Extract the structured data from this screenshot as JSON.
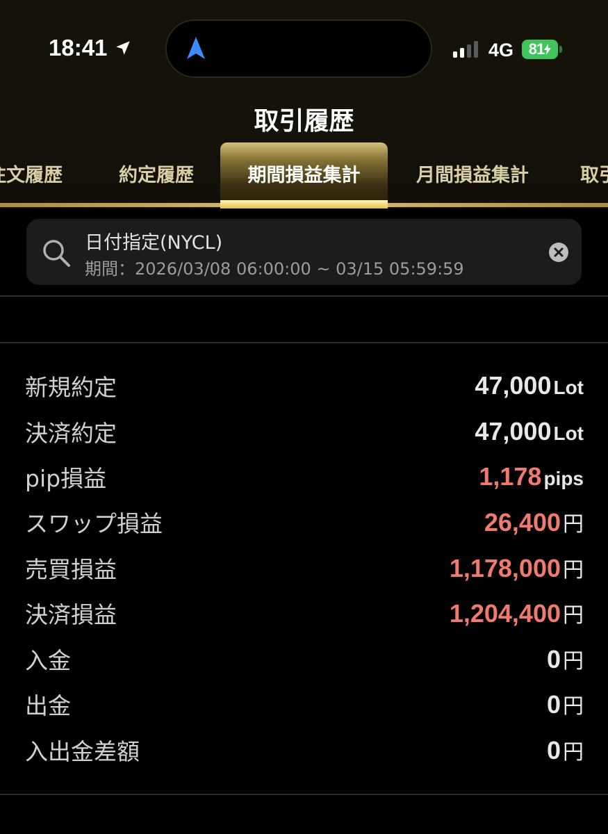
{
  "status": {
    "time": "18:41",
    "network": "4G",
    "battery": "81"
  },
  "page": {
    "title": "取引履歴"
  },
  "tabs": [
    {
      "label": "注文履歴"
    },
    {
      "label": "約定履歴"
    },
    {
      "label": "期間損益集計",
      "active": true
    },
    {
      "label": "月間損益集計"
    },
    {
      "label": "取引"
    }
  ],
  "search": {
    "title": "日付指定(NYCL)",
    "period": "期間：2026/03/08 06:00:00 ~ 03/15 05:59:59"
  },
  "summary": [
    {
      "label": "新規約定",
      "value": "47,000",
      "unit": "Lot",
      "positive": false
    },
    {
      "label": "決済約定",
      "value": "47,000",
      "unit": "Lot",
      "positive": false
    },
    {
      "label": "pip損益",
      "value": "1,178",
      "unit": "pips",
      "positive": true
    },
    {
      "label": "スワップ損益",
      "value": "26,400",
      "unit": "円",
      "positive": true
    },
    {
      "label": "売買損益",
      "value": "1,178,000",
      "unit": "円",
      "positive": true
    },
    {
      "label": "決済損益",
      "value": "1,204,400",
      "unit": "円",
      "positive": true
    },
    {
      "label": "入金",
      "value": "0",
      "unit": "円",
      "positive": false
    },
    {
      "label": "出金",
      "value": "0",
      "unit": "円",
      "positive": false
    },
    {
      "label": "入出金差額",
      "value": "0",
      "unit": "円",
      "positive": false
    }
  ],
  "colors": {
    "accent_gold": "#d9c176",
    "positive": "#f07a6e",
    "battery": "#3ec45a"
  }
}
